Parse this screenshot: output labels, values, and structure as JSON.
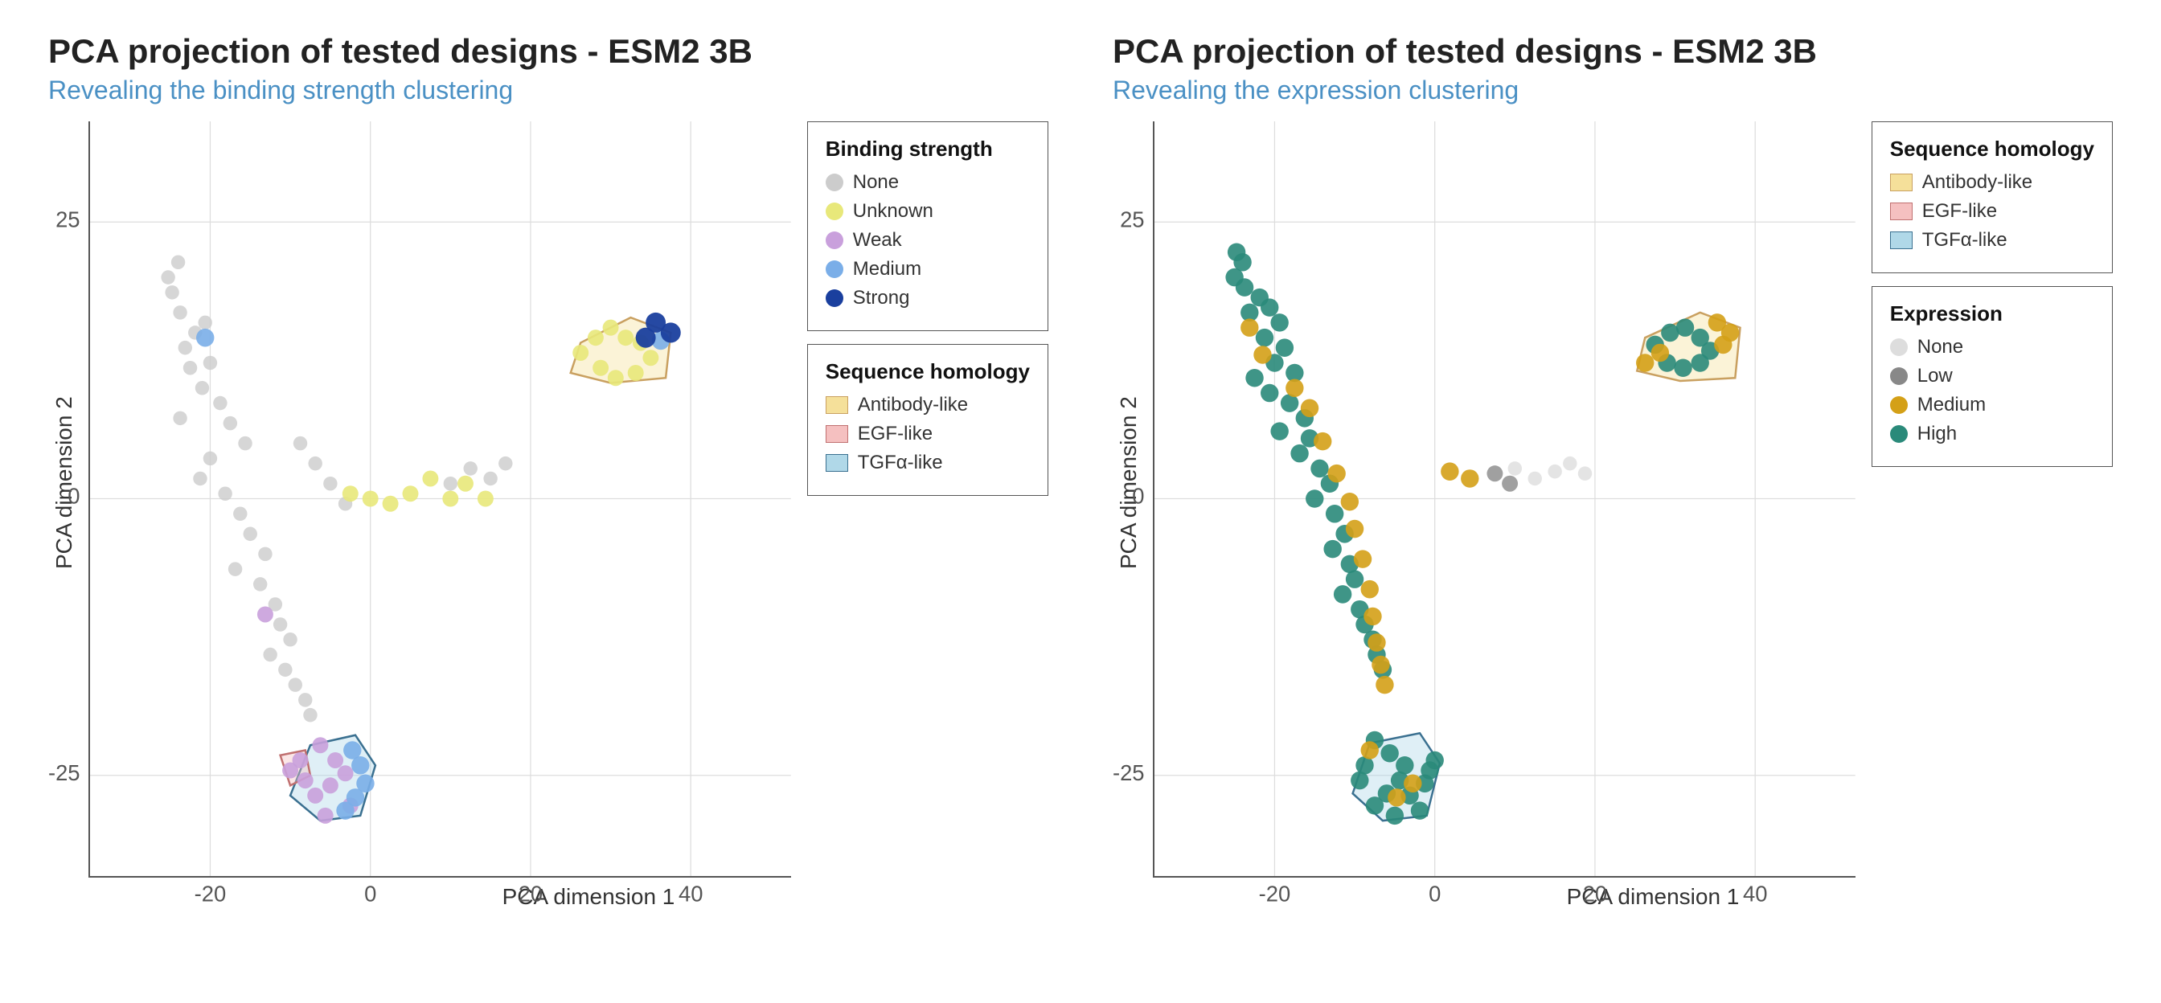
{
  "chart1": {
    "title": "PCA projection of tested designs - ESM2 3B",
    "subtitle": "Revealing the binding strength clustering",
    "xAxisLabel": "PCA dimension 1",
    "yAxisLabel": "PCA dimension 2",
    "legend1": {
      "title": "Binding strength",
      "items": [
        {
          "label": "None",
          "color": "#cccccc",
          "type": "dot"
        },
        {
          "label": "Unknown",
          "color": "#e8e87a",
          "type": "dot"
        },
        {
          "label": "Weak",
          "color": "#c9a0dc",
          "type": "dot"
        },
        {
          "label": "Medium",
          "color": "#7aaee8",
          "type": "dot"
        },
        {
          "label": "Strong",
          "color": "#1a3f9e",
          "type": "dot"
        }
      ]
    },
    "legend2": {
      "title": "Sequence homology",
      "items": [
        {
          "label": "Antibody-like",
          "color": "#f5e09a",
          "type": "swatch"
        },
        {
          "label": "EGF-like",
          "color": "#f5c0c0",
          "type": "swatch"
        },
        {
          "label": "TGFα-like",
          "color": "#b0d8e8",
          "type": "swatch"
        }
      ]
    }
  },
  "chart2": {
    "title": "PCA projection of tested designs - ESM2 3B",
    "subtitle": "Revealing the expression clustering",
    "xAxisLabel": "PCA dimension 1",
    "yAxisLabel": "PCA dimension 2",
    "legend1": {
      "title": "Sequence homology",
      "items": [
        {
          "label": "Antibody-like",
          "color": "#f5e09a",
          "type": "swatch"
        },
        {
          "label": "EGF-like",
          "color": "#f5c0c0",
          "type": "swatch"
        },
        {
          "label": "TGFα-like",
          "color": "#b0d8e8",
          "type": "swatch"
        }
      ]
    },
    "legend2": {
      "title": "Expression",
      "items": [
        {
          "label": "None",
          "color": "#dddddd",
          "type": "dot"
        },
        {
          "label": "Low",
          "color": "#888888",
          "type": "dot"
        },
        {
          "label": "Medium",
          "color": "#d4a017",
          "type": "dot"
        },
        {
          "label": "High",
          "color": "#2a8a7a",
          "type": "dot"
        }
      ]
    }
  },
  "axes": {
    "xTicks": [
      "-20",
      "0",
      "20",
      "40"
    ],
    "yTicks": [
      "25",
      "0",
      "-25"
    ]
  }
}
